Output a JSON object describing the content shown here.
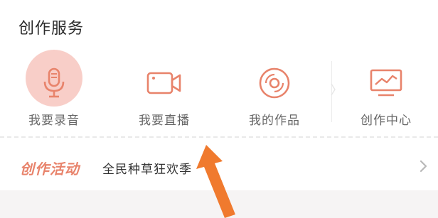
{
  "section": {
    "title": "创作服务"
  },
  "services": [
    {
      "label": "我要录音",
      "icon": "microphone-icon"
    },
    {
      "label": "我要直播",
      "icon": "video-camera-icon"
    },
    {
      "label": "我的作品",
      "icon": "disc-icon"
    },
    {
      "label": "创作中心",
      "icon": "monitor-chart-icon"
    }
  ],
  "activity": {
    "label": "创作活动",
    "text": "全民种草狂欢季"
  },
  "colors": {
    "accent": "#e8836b",
    "highlight": "#f7c9c2",
    "annotation_arrow": "#f07a2e"
  }
}
